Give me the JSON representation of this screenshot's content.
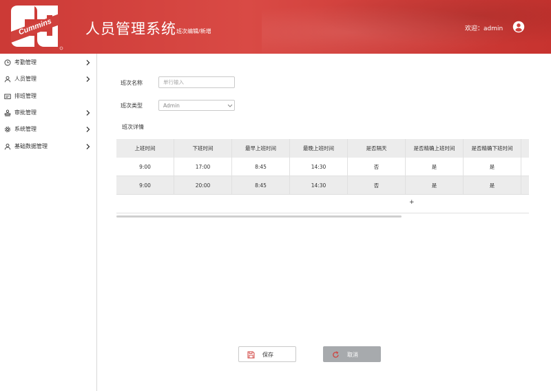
{
  "colors": {
    "brand_red": "#d0413d",
    "header_text": "#ffffff",
    "table_header_bg": "#ececec",
    "cancel_bg": "#a7aaad"
  },
  "header": {
    "logo_text": "Cummins",
    "title": "人员管理系统",
    "subtitle": "班次编辑/新增",
    "welcome": "欢迎：admin",
    "user_icon": "account-circle-icon"
  },
  "sidebar": {
    "items": [
      {
        "label": "考勤管理",
        "icon": "clock-icon",
        "has_children": true
      },
      {
        "label": "人员管理",
        "icon": "person-icon",
        "has_children": true
      },
      {
        "label": "排班管理",
        "icon": "schedule-card-icon",
        "has_children": false
      },
      {
        "label": "审批管理",
        "icon": "stamp-icon",
        "has_children": true
      },
      {
        "label": "系统管理",
        "icon": "gear-icon",
        "has_children": true
      },
      {
        "label": "基础数据管理",
        "icon": "person-icon",
        "has_children": true
      }
    ]
  },
  "form": {
    "shift_name_label": "班次名称",
    "shift_name_placeholder": "单行输入",
    "shift_name_value": "",
    "shift_type_label": "班次类型",
    "shift_type_value": "Admin",
    "details_label": "班次详情"
  },
  "table": {
    "columns": [
      "上班时间",
      "下班时间",
      "最早上班时间",
      "最晚上班时间",
      "是否隔天",
      "是否精确上班时间",
      "是否精确下班时间"
    ],
    "rows": [
      [
        "9:00",
        "17:00",
        "8:45",
        "14:30",
        "否",
        "是",
        "是"
      ],
      [
        "9:00",
        "20:00",
        "8:45",
        "14:30",
        "否",
        "是",
        "是"
      ]
    ],
    "add_row_symbol": "+"
  },
  "buttons": {
    "save_label": "保存",
    "save_icon": "floppy-disk-icon",
    "cancel_label": "取消",
    "cancel_icon": "refresh-icon"
  }
}
